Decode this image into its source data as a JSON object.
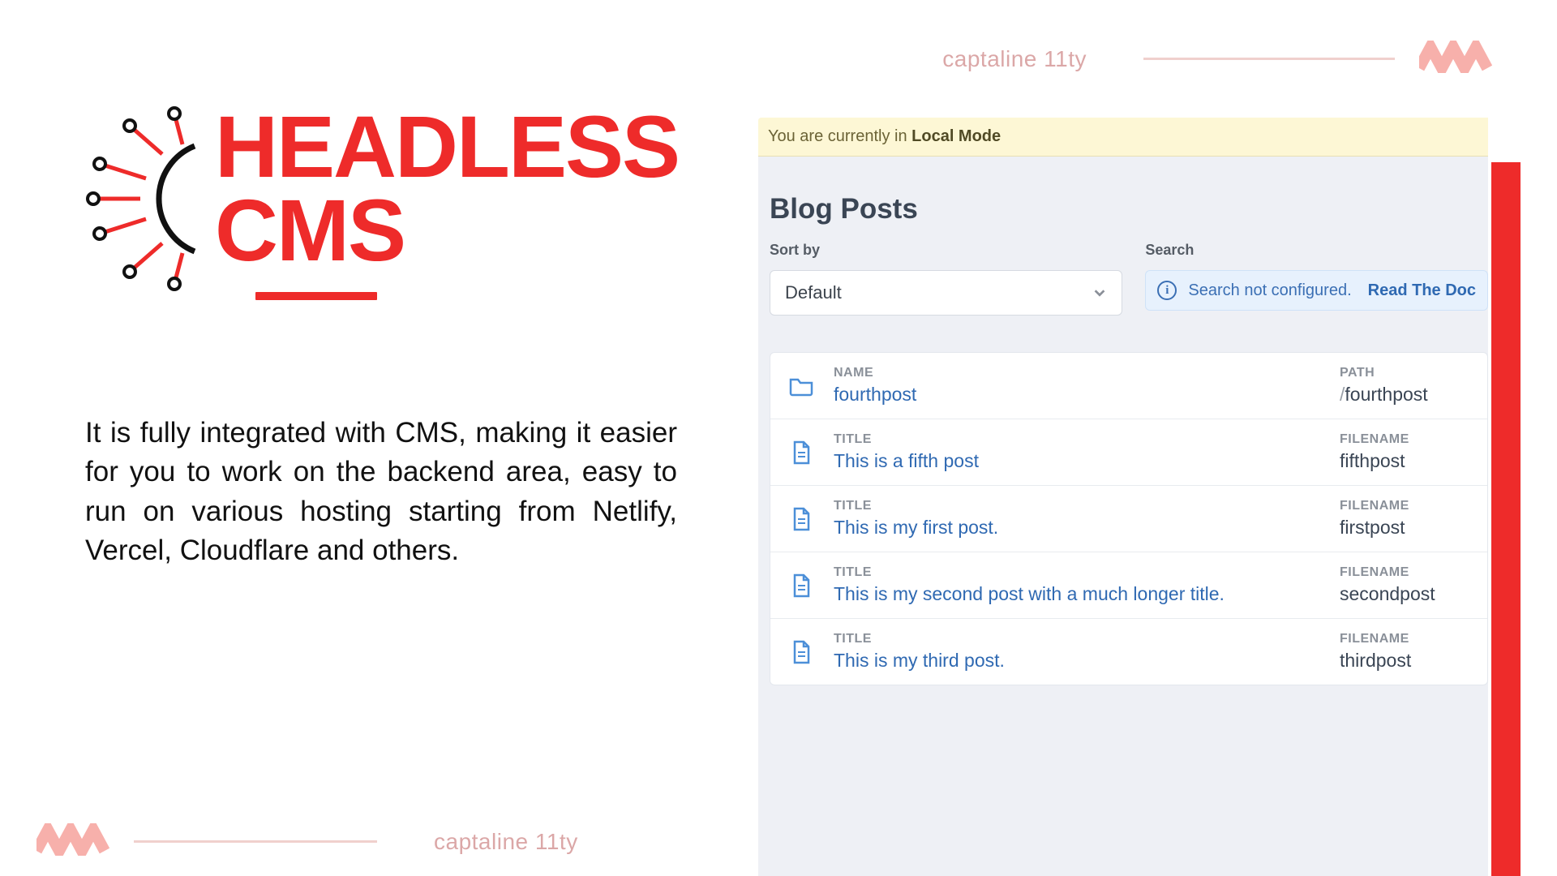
{
  "brand": {
    "label_top": "captaline 11ty",
    "label_bottom": "captaline 11ty"
  },
  "heading": {
    "title_line1": "HEADLESS",
    "title_line2": "CMS"
  },
  "description": "It is fully integrated with CMS, making it easier for you to work on the backend area, easy to run on various hosting starting from Netlify, Vercel, Cloudflare and others.",
  "panel": {
    "localmode_prefix": "You are currently in ",
    "localmode_strong": "Local Mode",
    "title": "Blog Posts",
    "sort_label": "Sort by",
    "sort_value": "Default",
    "search_label": "Search",
    "search_msg": "Search not configured.",
    "search_link": "Read The Doc",
    "cols": {
      "name": "NAME",
      "title": "TITLE",
      "path": "PATH",
      "filename": "FILENAME"
    },
    "rows": [
      {
        "type": "folder",
        "left_key": "NAME",
        "left_val": "fourthpost",
        "right_key": "PATH",
        "right_val": "fourthpost",
        "right_prefix": "/"
      },
      {
        "type": "file",
        "left_key": "TITLE",
        "left_val": "This is a fifth post",
        "right_key": "FILENAME",
        "right_val": "fifthpost",
        "right_prefix": ""
      },
      {
        "type": "file",
        "left_key": "TITLE",
        "left_val": "This is my first post.",
        "right_key": "FILENAME",
        "right_val": "firstpost",
        "right_prefix": ""
      },
      {
        "type": "file",
        "left_key": "TITLE",
        "left_val": "This is my second post with a much longer title.",
        "right_key": "FILENAME",
        "right_val": "secondpost",
        "right_prefix": ""
      },
      {
        "type": "file",
        "left_key": "TITLE",
        "left_val": "This is my third post.",
        "right_key": "FILENAME",
        "right_val": "thirdpost",
        "right_prefix": ""
      }
    ]
  }
}
